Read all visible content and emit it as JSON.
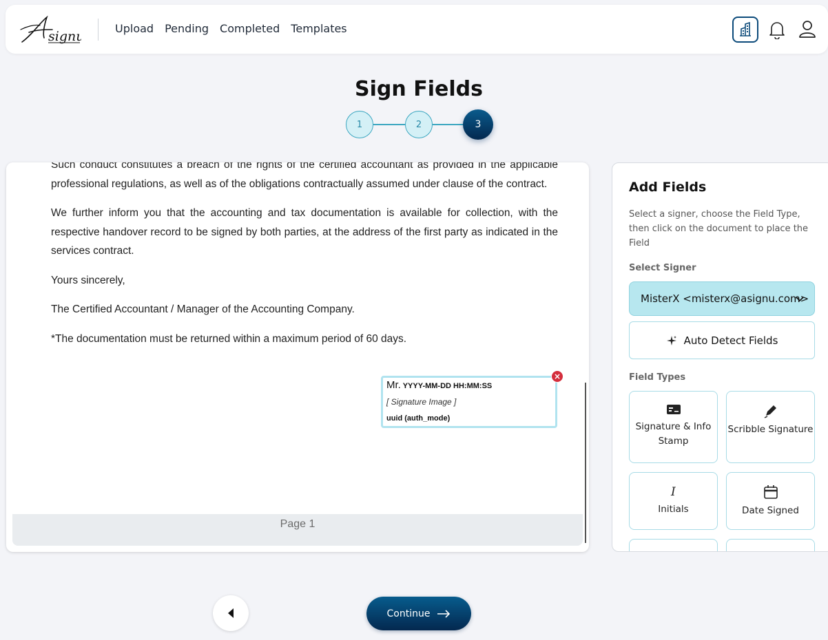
{
  "brand": {
    "logo_text": "Asignu"
  },
  "nav": {
    "links": [
      "Upload",
      "Pending",
      "Completed",
      "Templates"
    ]
  },
  "header": {
    "title": "Sign Fields",
    "steps": [
      "1",
      "2",
      "3"
    ],
    "active_step": 3
  },
  "document": {
    "paragraphs": [
      "Such conduct constitutes a breach of the rights of the certified accountant as provided in the applicable professional regulations, as well as of the obligations contractually assumed under clause of the contract.",
      "We further inform you that the accounting and tax documentation is available for collection, with the respective handover record to be signed by both parties, at the address of the first party as indicated in the services contract.",
      "Yours sincerely,",
      "The Certified Accountant / Manager of the Accounting Company.",
      "*The documentation must be returned within a maximum period of 60 days."
    ],
    "page_label": "Page 1",
    "signature_field": {
      "name_prefix": "Mr.",
      "datetime_format": "YYYY-MM-DD HH:MM:SS",
      "image_placeholder": "[ Signature Image ]",
      "footer": "uuid (auth_mode)"
    }
  },
  "sidebar": {
    "title": "Add Fields",
    "description": "Select a signer, choose the Field Type, then click on the document to place the Field",
    "select_signer_label": "Select Signer",
    "selected_signer": "MisterX <misterx@asignu.com>",
    "auto_detect_label": "Auto Detect Fields",
    "field_types_label": "Field Types",
    "field_types": [
      {
        "label": "Signature & Info Stamp",
        "icon": "stamp-card-icon"
      },
      {
        "label": "Scribble Signature",
        "icon": "pen-icon"
      },
      {
        "label": "Initials",
        "icon": "italic-i-icon"
      },
      {
        "label": "Date Signed",
        "icon": "calendar-icon"
      }
    ]
  },
  "footer": {
    "continue_label": "Continue"
  },
  "colors": {
    "primary": "#04284f",
    "accent": "#3ba6c0",
    "signer_bg": "#b7e7ef",
    "danger": "#d42e3c"
  }
}
